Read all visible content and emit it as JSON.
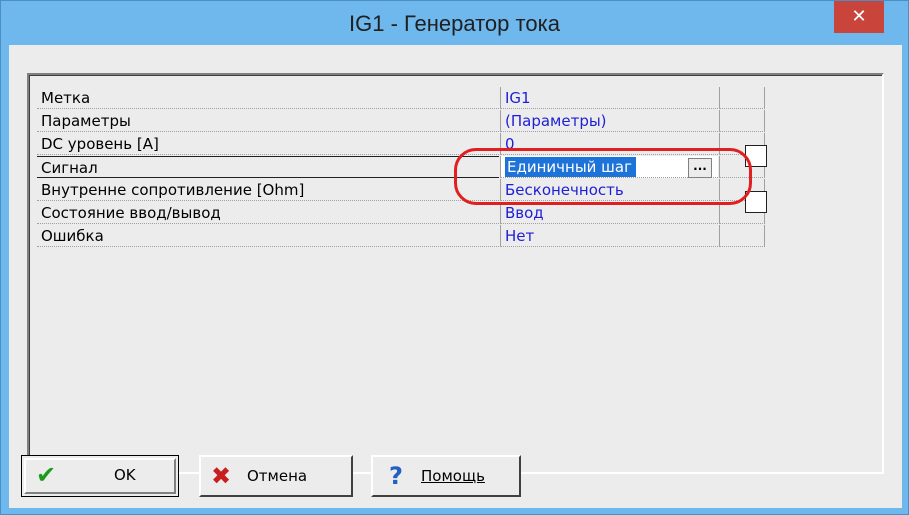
{
  "window": {
    "title": "IG1 - Генератор тока",
    "close_glyph": "✕"
  },
  "properties": [
    {
      "key": "Метка",
      "value": "IG1"
    },
    {
      "key": "Параметры",
      "value": "(Параметры)"
    },
    {
      "key": "DC уровень [A]",
      "value": "0"
    },
    {
      "key": "Сигнал",
      "value": "Единичный шаг"
    },
    {
      "key": "Внутренне сопротивление [Ohm]",
      "value": "Бесконечность"
    },
    {
      "key": "Состояние ввод/вывод",
      "value": "Ввод"
    },
    {
      "key": "Ошибка",
      "value": "Нет"
    }
  ],
  "ellipsis_label": "...",
  "buttons": {
    "ok": {
      "label": "OK",
      "icon": "checkmark-icon",
      "color": "#1c9a1c"
    },
    "cancel": {
      "label": "Отмена",
      "icon": "x-icon",
      "color": "#c81e1e"
    },
    "help": {
      "label": "Помощь",
      "icon": "question-mark-icon",
      "color": "#2060c0"
    }
  },
  "accent_colors": {
    "titlebar": "#6fb8ee",
    "close": "#c9443a",
    "value_text": "#1e1ed8",
    "selection": "#1e73d8",
    "highlight_ring": "#e02020"
  }
}
